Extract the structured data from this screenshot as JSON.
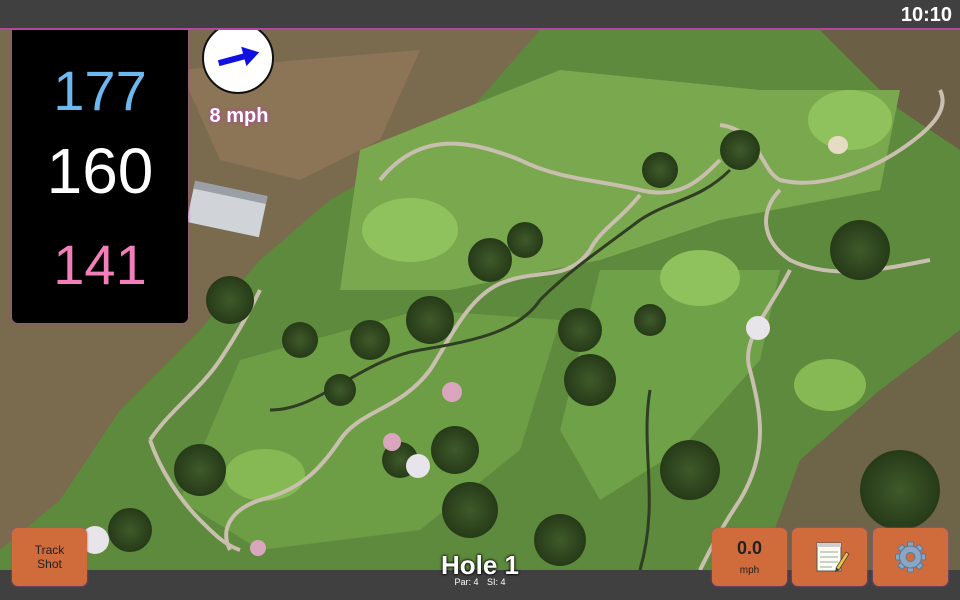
{
  "status": {
    "time": "10:10"
  },
  "distances": {
    "back": "177",
    "center": "160",
    "front": "141"
  },
  "wind": {
    "speed_label": "8 mph",
    "icon": "wind-arrow-icon"
  },
  "hole": {
    "title": "Hole 1",
    "par": "Par: 4",
    "si": "SI: 4"
  },
  "buttons": {
    "track_shot": "Track\nShot",
    "speed_value": "0.0",
    "speed_unit": "mph",
    "notes_icon": "notepad-icon",
    "settings_icon": "gear-icon"
  },
  "colors": {
    "accent": "#b04aa0",
    "button": "#d06b3c",
    "back_distance": "#6db8ef",
    "front_distance": "#f27fb9"
  }
}
